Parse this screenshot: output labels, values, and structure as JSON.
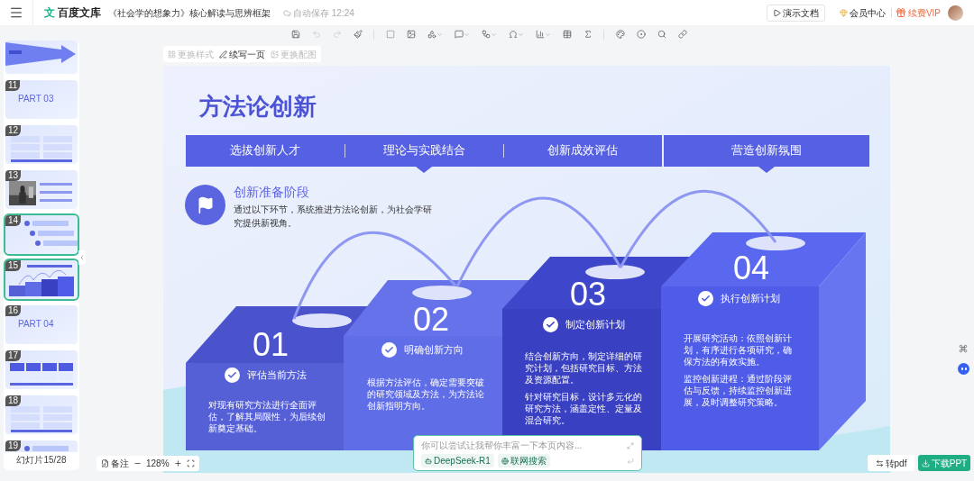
{
  "header": {
    "logo_mark": "文",
    "logo_text": "百度文库",
    "doc_title": "《社会学的想象力》核心解读与思辨框架",
    "autosave": "自动保存 12:24",
    "present_button": "演示文档",
    "member_center": "会员中心",
    "vip": "续费VIP"
  },
  "toolbar": {
    "undo_disabled": true,
    "redo_disabled": true
  },
  "slide_actions": [
    {
      "label": "更换样式",
      "disabled": true
    },
    {
      "label": "续写一页",
      "disabled": false
    },
    {
      "label": "更换配图",
      "disabled": true
    }
  ],
  "thumbnails": [
    {
      "kind": "flow",
      "selected": false
    },
    {
      "number": "11",
      "kind": "part",
      "title": "PART 03",
      "selected": false
    },
    {
      "number": "12",
      "kind": "grid",
      "selected": false
    },
    {
      "number": "13",
      "selected": false
    },
    {
      "number": "14",
      "kind": "list",
      "selected": true
    },
    {
      "number": "15",
      "kind": "steps",
      "selected": true
    },
    {
      "number": "16",
      "kind": "part",
      "title": "PART 04",
      "selected": false
    },
    {
      "number": "17",
      "kind": "columns",
      "selected": false
    },
    {
      "number": "18",
      "kind": "grid",
      "selected": false
    },
    {
      "number": "19",
      "kind": "list",
      "selected": false
    }
  ],
  "slide_counter": "幻灯片15/28",
  "slide": {
    "title": "方法论创新",
    "tabs": [
      {
        "label": "选拔创新人才",
        "pointer": false
      },
      {
        "label": "理论与实践结合",
        "pointer": true
      },
      {
        "label": "创新成效评估",
        "pointer": false
      },
      {
        "label": "营造创新氛围",
        "pointer": true
      }
    ],
    "section": {
      "heading": "创新准备阶段",
      "text": "通过以下环节，系统推进方法论创新，为社会学研究提供新视角。"
    },
    "steps": [
      {
        "number": "01",
        "label": "评估当前方法",
        "paragraphs": [
          "对现有研究方法进行全面评估，了解其局限性，为后续创新奠定基础。"
        ]
      },
      {
        "number": "02",
        "label": "明确创新方向",
        "paragraphs": [
          "根据方法评估，确定需要突破的研究领域及方法，为方法论创新指明方向。"
        ]
      },
      {
        "number": "03",
        "label": "制定创新计划",
        "paragraphs": [
          "结合创新方向，制定详细的研究计划，包括研究目标、方法及资源配置。",
          "针对研究目标，设计多元化的研究方法，涵盖定性、定量及混合研究。"
        ]
      },
      {
        "number": "04",
        "label": "执行创新计划",
        "paragraphs": [
          "开展研究活动：依照创新计划，有序进行各项研究，确保方法的有效实施。",
          "监控创新进程：通过阶段评估与反馈，持续监控创新进展，及时调整研究策略。"
        ]
      }
    ]
  },
  "zoom_control": {
    "notes": "备注",
    "percent": "128%"
  },
  "ai_box": {
    "placeholder": "你可以尝试让我帮你丰富一下本页内容...",
    "chips": [
      "DeepSeek-R1",
      "联网搜索"
    ]
  },
  "export": {
    "pdf": "转pdf",
    "download": "下载PPT"
  }
}
